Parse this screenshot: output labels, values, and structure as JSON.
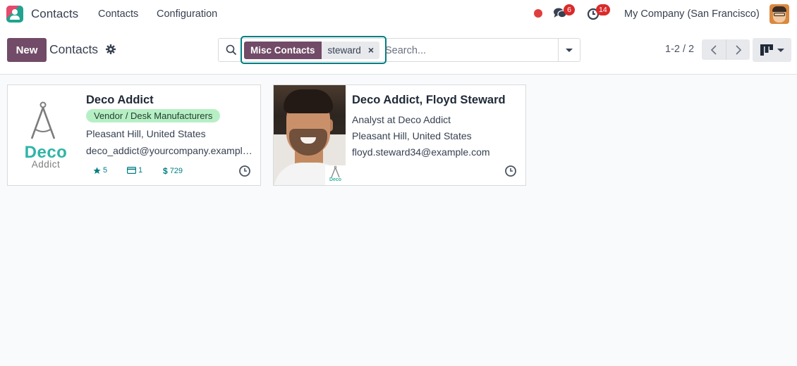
{
  "app": {
    "title": "Contacts",
    "menu": [
      {
        "label": "Contacts"
      },
      {
        "label": "Configuration"
      }
    ]
  },
  "systray": {
    "messages_count": "6",
    "activities_count": "14",
    "company": "My Company (San Francisco)",
    "status_color": "#e03e3e"
  },
  "control_panel": {
    "new_label": "New",
    "breadcrumb": "Contacts",
    "search": {
      "facet_label": "Misc Contacts",
      "facet_value": "steward",
      "facet_remove": "×",
      "placeholder": "Search..."
    },
    "pager": {
      "value": "1-2 / 2"
    }
  },
  "colors": {
    "brand": "#714b67",
    "accent": "#017e84",
    "tag_bg": "#b7efc5",
    "badge": "#d92b2b",
    "deco_logo": "#2fb5a6"
  },
  "cards": [
    {
      "name": "Deco Addict",
      "tag": "Vendor / Desk Manufacturers",
      "location": "Pleasant Hill, United States",
      "email": "deco_addict@yourcompany.example.com",
      "logo_text_1": "Deco",
      "logo_text_2": "Addict",
      "stats": {
        "rating": "5",
        "bank": "1",
        "sales": "729"
      },
      "image_icon": "deco-addict-logo-icon"
    },
    {
      "name": "Deco Addict, Floyd Steward",
      "function": "Analyst at Deco Addict",
      "location": "Pleasant Hill, United States",
      "email": "floyd.steward34@example.com",
      "mini_logo_text": "Deco",
      "image_icon": "person-photo-icon"
    }
  ]
}
